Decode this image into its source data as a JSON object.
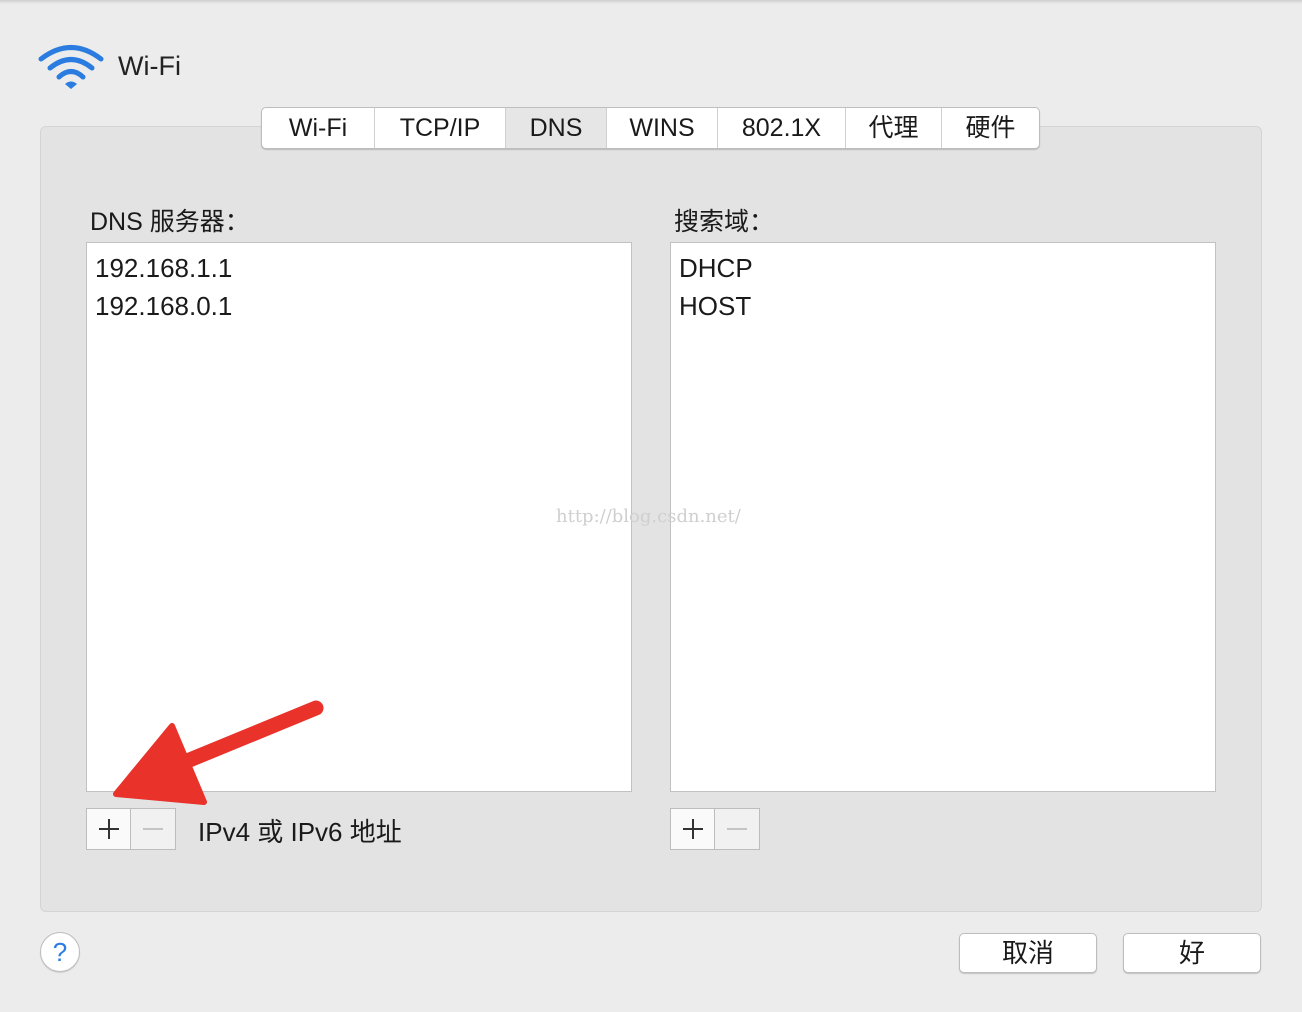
{
  "window": {
    "title": "Wi-Fi",
    "icon": "wifi-icon",
    "accent_color": "#2a7ce0"
  },
  "tabs": [
    {
      "label": "Wi-Fi",
      "selected": false
    },
    {
      "label": "TCP/IP",
      "selected": false
    },
    {
      "label": "DNS",
      "selected": true
    },
    {
      "label": "WINS",
      "selected": false
    },
    {
      "label": "802.1X",
      "selected": false
    },
    {
      "label": "代理",
      "selected": false
    },
    {
      "label": "硬件",
      "selected": false
    }
  ],
  "dns_servers": {
    "label": "DNS 服务器：",
    "items": [
      "192.168.1.1",
      "192.168.0.1"
    ],
    "add_icon": "plus-icon",
    "remove_icon": "minus-icon",
    "hint": "IPv4 或 IPv6 地址"
  },
  "search_domains": {
    "label": "搜索域：",
    "items": [
      "DHCP",
      "HOST"
    ],
    "add_icon": "plus-icon",
    "remove_icon": "minus-icon"
  },
  "watermark": "http://blog.csdn.net/",
  "annotation": {
    "icon": "arrow-icon",
    "color": "#e8322a"
  },
  "footer": {
    "help_label": "?",
    "cancel_label": "取消",
    "ok_label": "好"
  }
}
